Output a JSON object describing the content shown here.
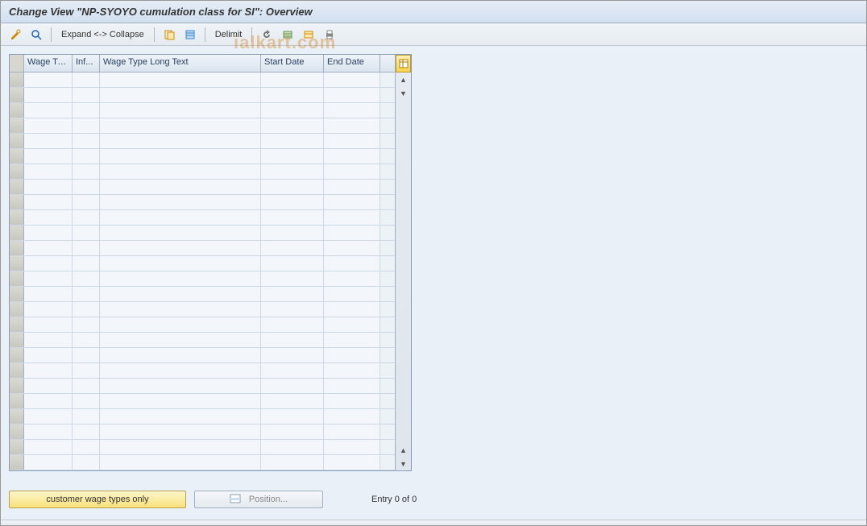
{
  "title": "Change View \"NP-SYOYO cumulation class for SI\": Overview",
  "toolbar": {
    "expand_collapse": "Expand <-> Collapse",
    "delimit": "Delimit"
  },
  "watermark": {
    "line1": "www.tutorialkart.com",
    "line2": "ialkart.com"
  },
  "table": {
    "columns": {
      "wage_type": "Wage Ty...",
      "inf": "Inf...",
      "long_text": "Wage Type Long Text",
      "start_date": "Start Date",
      "end_date": "End Date"
    },
    "rows": []
  },
  "footer": {
    "customer_wage_types": "customer wage types only",
    "position": "Position...",
    "entry_count": "Entry 0 of 0"
  }
}
